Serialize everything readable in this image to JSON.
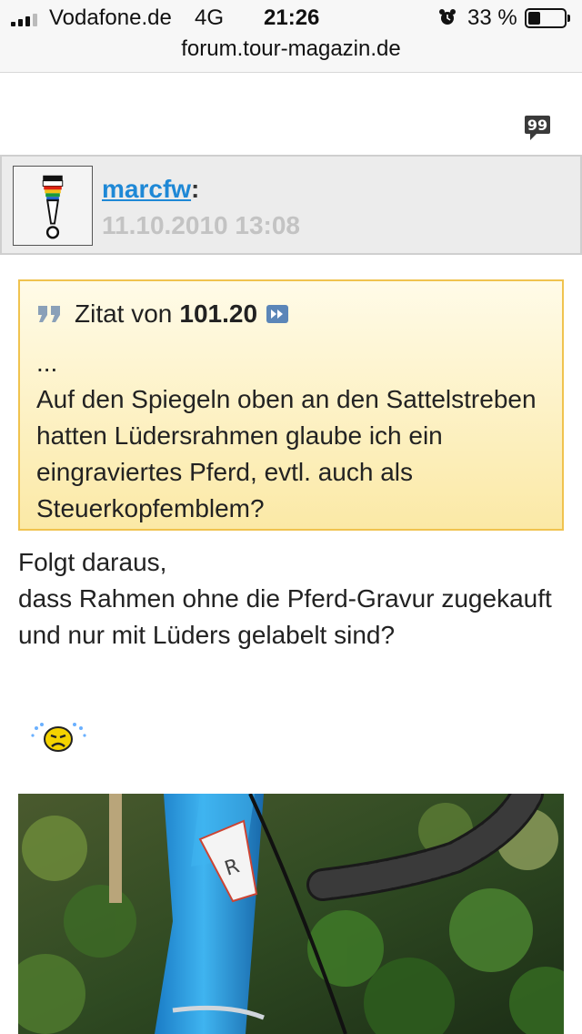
{
  "status_bar": {
    "carrier": "Vodafone.de",
    "network": "4G",
    "time": "21:26",
    "battery": "33 %",
    "battery_level": 0.33
  },
  "browser": {
    "url": "forum.tour-magazin.de"
  },
  "post": {
    "author": "marcfw",
    "author_suffix": ":",
    "date": "11.10.2010 13:08",
    "quote": {
      "prefix": "Zitat von",
      "author": "101.20",
      "text": "...\nAuf den Spiegeln oben an den Sattelstreben hatten Lüdersrahmen glaube ich ein eingraviertes Pferd, evtl. auch als Steuerkopfemblem?"
    },
    "text": "Folgt daraus,\ndass Rahmen ohne die Pferd-Gravur zugekauft und nur mit Lüders gelabelt sind?"
  },
  "icons": {
    "reply": "reply-quote-icon",
    "quote": "quote-marks-icon",
    "jump": "jump-to-post-icon",
    "smiley": "crying-smiley-icon",
    "alarm": "alarm-clock-icon"
  },
  "colors": {
    "link": "#1e88d6",
    "quote_border": "#f0c34f",
    "quote_bg": "#fbe9a6",
    "header_bg": "#ececec"
  }
}
